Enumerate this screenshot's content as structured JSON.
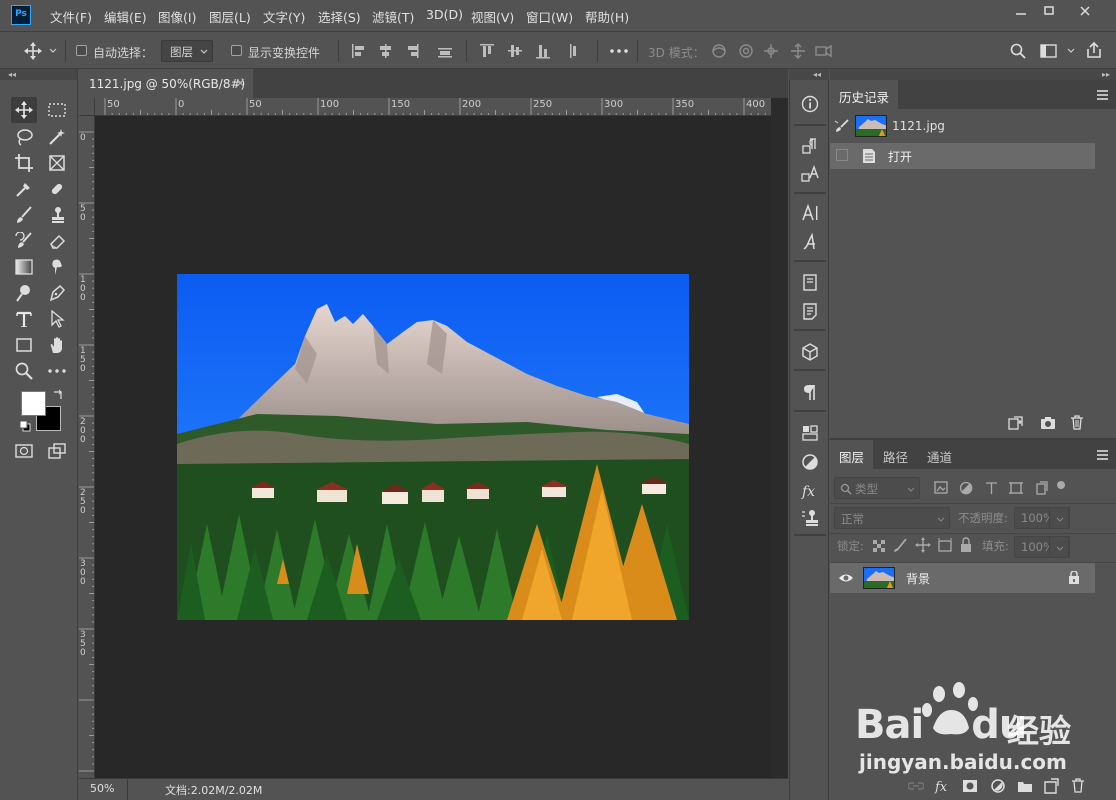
{
  "app": {
    "logo": "Ps"
  },
  "menu": {
    "items": [
      "文件(F)",
      "编辑(E)",
      "图像(I)",
      "图层(L)",
      "文字(Y)",
      "选择(S)",
      "滤镜(T)",
      "3D(D)",
      "视图(V)",
      "窗口(W)",
      "帮助(H)"
    ]
  },
  "options": {
    "auto_select_label": "自动选择：",
    "auto_select_value": "图层",
    "show_transform_label": "显示变换控件",
    "mode_3d_label": "3D 模式："
  },
  "document": {
    "tab_title": "1121.jpg @ 50%(RGB/8#)",
    "tab_close": "×",
    "ruler_top_labels": [
      "50",
      "0",
      "50",
      "100",
      "150",
      "200",
      "250",
      "300",
      "350",
      "400"
    ],
    "ruler_left_labels": [
      "0",
      "5\n0",
      "1\n0\n0",
      "1\n5\n0",
      "2\n0\n0",
      "2\n5\n0",
      "3\n0\n0",
      "3\n5\n0"
    ],
    "zoom": "50%",
    "doc_size": "文档:2.02M/2.02M"
  },
  "history": {
    "tabs": [
      "历史记录"
    ],
    "snapshot_name": "1121.jpg",
    "steps": [
      {
        "label": "打开"
      }
    ]
  },
  "layers": {
    "tabs": [
      "图层",
      "路径",
      "通道"
    ],
    "filter_kind": "类型",
    "blend_mode": "正常",
    "opacity_label": "不透明度:",
    "opacity_value": "100%",
    "lock_label": "锁定:",
    "fill_label": "填充:",
    "fill_value": "100%",
    "items": [
      {
        "name": "背景",
        "visible": true,
        "locked": true
      }
    ]
  },
  "watermark": {
    "brand_text": "Bai",
    "brand_text2": "du",
    "cn_text": "经验",
    "url": "jingyan.baidu.com"
  },
  "colors": {
    "panel": "#535353",
    "canvas": "#282828",
    "accent": "#31a8ff",
    "sky": "#1a6ff5"
  }
}
